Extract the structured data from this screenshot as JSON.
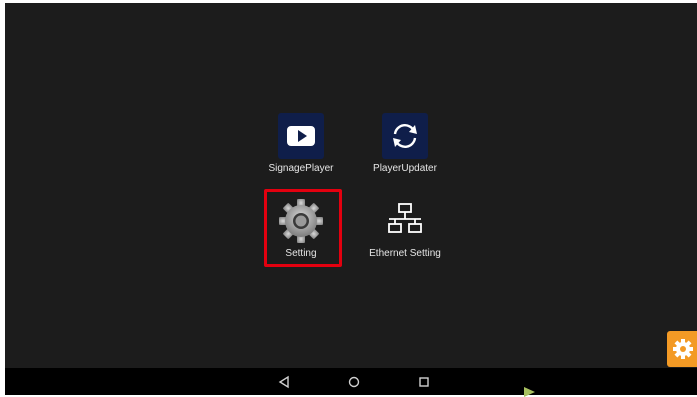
{
  "apps": [
    {
      "id": "signage-player",
      "label": "SignagePlayer",
      "icon": "play-icon"
    },
    {
      "id": "player-updater",
      "label": "PlayerUpdater",
      "icon": "sync-icon"
    },
    {
      "id": "setting",
      "label": "Setting",
      "icon": "gear-icon",
      "highlighted": true
    },
    {
      "id": "ethernet-setting",
      "label": "Ethernet Setting",
      "icon": "network-icon"
    }
  ],
  "navbar": {
    "back_icon": "back-triangle-icon",
    "home_icon": "home-circle-icon",
    "recents_icon": "recents-square-icon"
  },
  "floating_button": {
    "icon": "gear-icon",
    "color": "#f39a25"
  },
  "colors": {
    "screen_bg": "#1c1c1c",
    "icon_tile": "#0f1e4a",
    "highlight": "#e3000f"
  }
}
